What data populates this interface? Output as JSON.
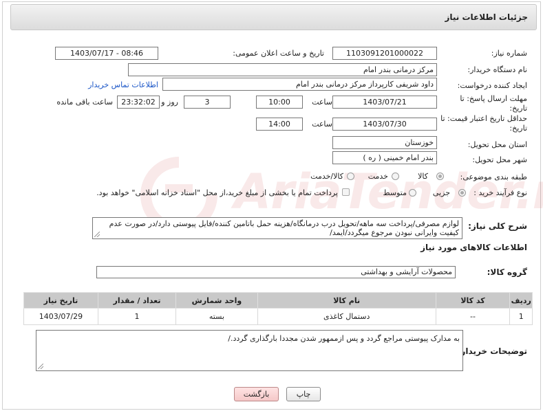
{
  "header": {
    "title": "جزئیات اطلاعات نیاز"
  },
  "form": {
    "need_number": {
      "label": "شماره نیاز:",
      "value": "1103091201000022"
    },
    "announce": {
      "label": "تاریخ و ساعت اعلان عمومی:",
      "value": "1403/07/17 - 08:46"
    },
    "buyer_org": {
      "label": "نام دستگاه خریدار:",
      "value": "مرکز درمانی بندر امام"
    },
    "requester": {
      "label": "ایجاد کننده درخواست:",
      "value": "داود شریفی کارپرداز مرکز درمانی بندر امام",
      "contact_link": "اطلاعات تماس خریدار"
    },
    "deadline": {
      "label_line1": "مهلت ارسال پاسخ: تا",
      "label_line2": "تاریخ:",
      "date": "1403/07/21",
      "time_label": "ساعت",
      "time": "10:00",
      "days": "3",
      "days_label": "روز و",
      "remaining": "23:32:02",
      "remaining_label": "ساعت باقی مانده"
    },
    "validity": {
      "label_line1": "حداقل تاریخ اعتبار قیمت: تا",
      "label_line2": "تاریخ:",
      "date": "1403/07/30",
      "time_label": "ساعت",
      "time": "14:00"
    },
    "province": {
      "label": "استان محل تحویل:",
      "value": "خوزستان"
    },
    "city": {
      "label": "شهر محل تحویل:",
      "value": "بندر امام خمینی ( ره )"
    },
    "category": {
      "label": "طبقه بندی موضوعی:",
      "options": [
        "کالا",
        "خدمت",
        "کالا/خدمت"
      ],
      "selected": "کالا"
    },
    "process": {
      "label": "نوع فرآیند خرید :",
      "options": [
        "جزیی",
        "متوسط"
      ],
      "selected": "جزیی",
      "note": "پرداخت تمام یا بخشی از مبلغ خرید،از محل \"اسناد خزانه اسلامی\" خواهد بود."
    },
    "description": {
      "label": "شرح کلی نیاز:",
      "value": "لوازم مصرفی/پرداخت سه ماهه/تحویل درب درمانگاه/هزینه حمل باتامین کننده/فایل پیوستی دارد/در صورت عدم کیفیت وایرانی نبودن مرجوع میگردد/ایمد/"
    }
  },
  "goods": {
    "section_title": "اطلاعات کالاهای مورد نیاز",
    "group_label": "گروه کالا:",
    "group_value": "محصولات آرایشی و بهداشتی",
    "columns": [
      "ردیف",
      "کد کالا",
      "نام کالا",
      "واحد شمارش",
      "تعداد / مقدار",
      "تاریخ نیاز"
    ],
    "rows": [
      [
        "1",
        "--",
        "دستمال کاغذی",
        "بسته",
        "1",
        "1403/07/29"
      ]
    ]
  },
  "buyer_notes": {
    "label": "توضیحات خریدار:",
    "value": "به مدارک پیوستی مراجع گردد و پس ازممهور شدن مجددا بارگذاری گردد./"
  },
  "buttons": {
    "print": "چاپ",
    "back": "بازگشت"
  },
  "watermark": {
    "text": "AriaTender.neT"
  }
}
